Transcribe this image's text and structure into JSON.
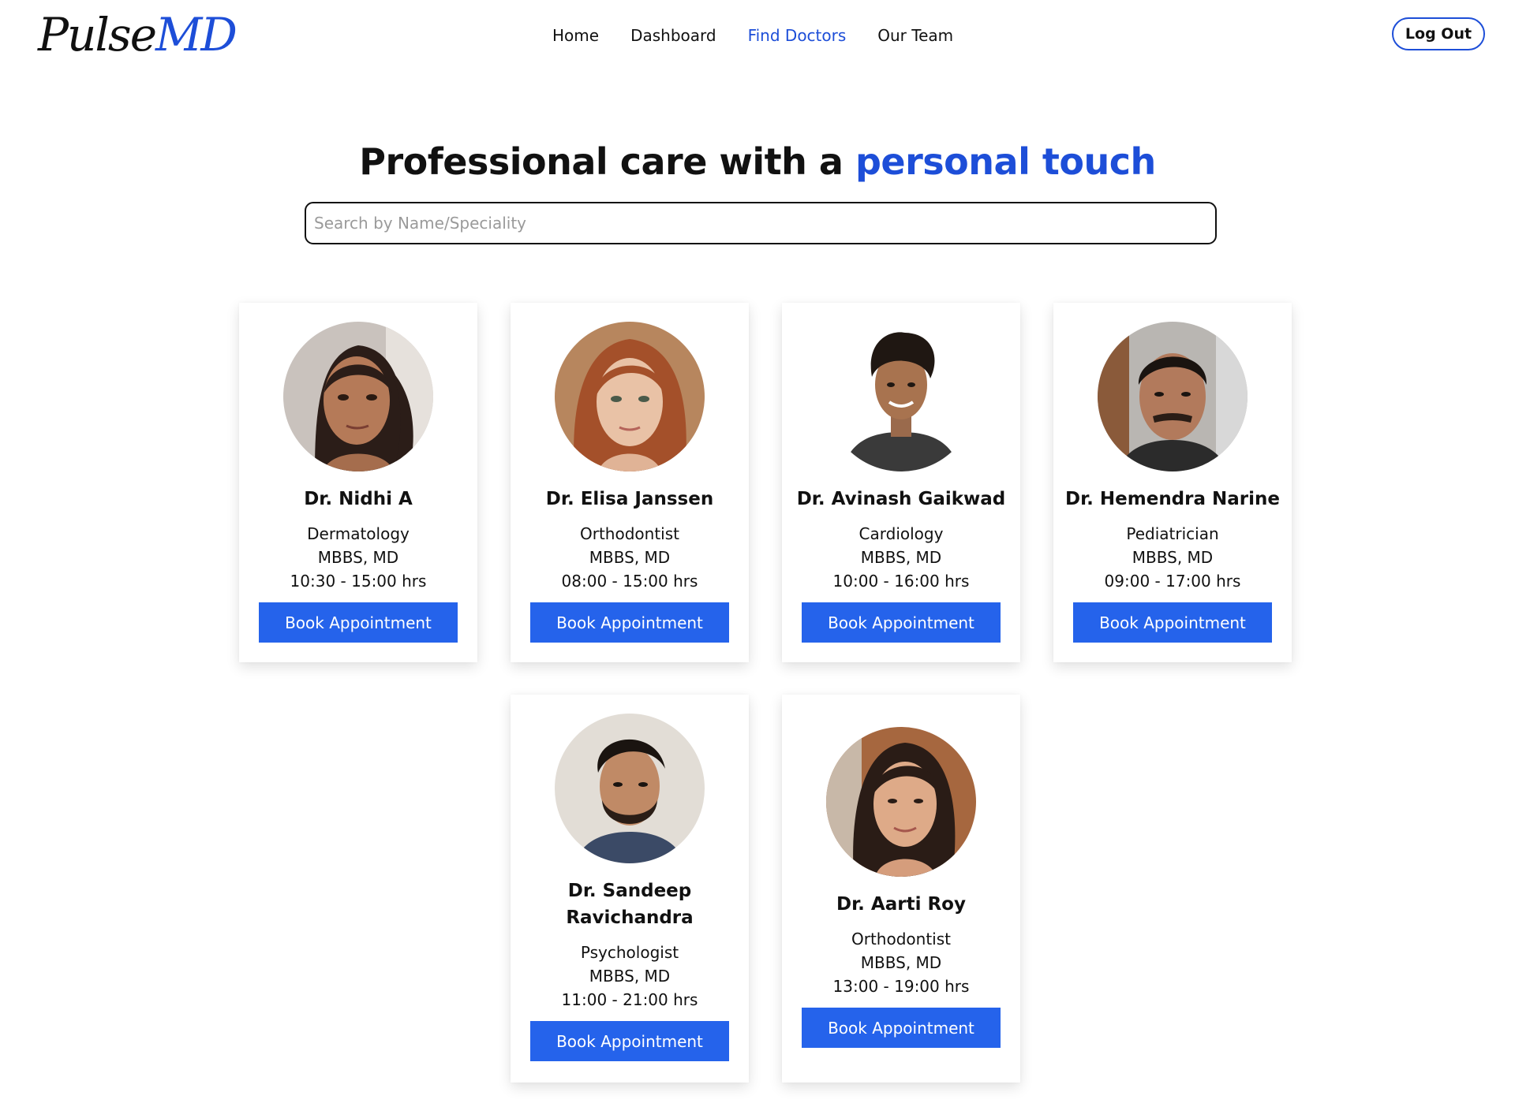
{
  "header": {
    "logo": {
      "part1": "Pulse",
      "part2": "MD"
    },
    "nav": [
      {
        "label": "Home",
        "active": false
      },
      {
        "label": "Dashboard",
        "active": false
      },
      {
        "label": "Find Doctors",
        "active": true
      },
      {
        "label": "Our Team",
        "active": false
      }
    ],
    "logout_label": "Log Out"
  },
  "hero": {
    "title_plain": "Professional care with a ",
    "title_accent": "personal touch"
  },
  "search": {
    "placeholder": "Search by Name/Speciality",
    "value": ""
  },
  "doctors": [
    {
      "name": "Dr. Nidhi A",
      "specialty": "Dermatology",
      "qualification": "MBBS, MD",
      "hours": "10:30 - 15:00 hrs",
      "button": "Book Appointment"
    },
    {
      "name": "Dr. Elisa Janssen",
      "specialty": "Orthodontist",
      "qualification": "MBBS, MD",
      "hours": "08:00 - 15:00 hrs",
      "button": "Book Appointment"
    },
    {
      "name": "Dr. Avinash Gaikwad",
      "specialty": "Cardiology",
      "qualification": "MBBS, MD",
      "hours": "10:00 - 16:00 hrs",
      "button": "Book Appointment"
    },
    {
      "name": "Dr. Hemendra Narine",
      "specialty": "Pediatrician",
      "qualification": "MBBS, MD",
      "hours": "09:00 - 17:00 hrs",
      "button": "Book Appointment"
    },
    {
      "name": "Dr. Sandeep Ravichandra",
      "specialty": "Psychologist",
      "qualification": "MBBS, MD",
      "hours": "11:00 - 21:00 hrs",
      "button": "Book Appointment"
    },
    {
      "name": "Dr. Aarti Roy",
      "specialty": "Orthodontist",
      "qualification": "MBBS, MD",
      "hours": "13:00 - 19:00 hrs",
      "button": "Book Appointment"
    }
  ],
  "colors": {
    "accent": "#1d4ed8",
    "button": "#2563eb",
    "text": "#111111"
  }
}
